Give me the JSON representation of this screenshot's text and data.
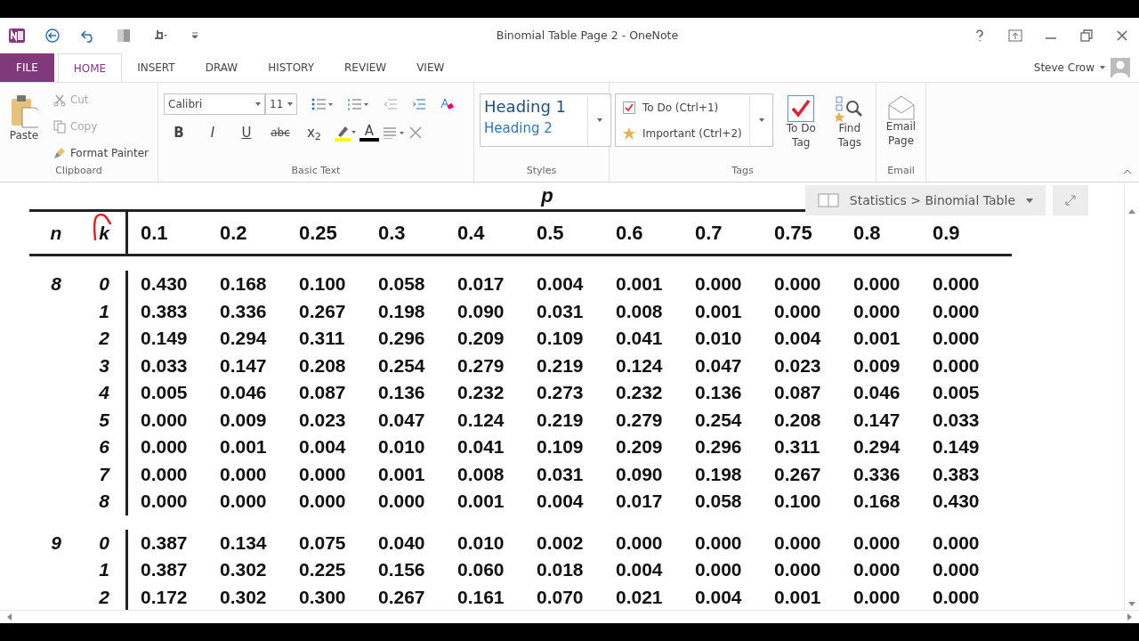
{
  "window": {
    "title": "Binomial Table Page 2 - OneNote"
  },
  "user": {
    "name": "Steve Crow"
  },
  "tabs": [
    {
      "label": "FILE",
      "kind": "file",
      "selected": false
    },
    {
      "label": "HOME",
      "kind": "tab",
      "selected": true
    },
    {
      "label": "INSERT",
      "kind": "tab",
      "selected": false
    },
    {
      "label": "DRAW",
      "kind": "tab",
      "selected": false
    },
    {
      "label": "HISTORY",
      "kind": "tab",
      "selected": false
    },
    {
      "label": "REVIEW",
      "kind": "tab",
      "selected": false
    },
    {
      "label": "VIEW",
      "kind": "tab",
      "selected": false
    }
  ],
  "clipboard": {
    "paste": "Paste",
    "group": "Clipboard",
    "items": [
      {
        "label": "Cut",
        "kind": "cut",
        "disabled": true
      },
      {
        "label": "Copy",
        "kind": "copy",
        "disabled": true
      },
      {
        "label": "Format Painter",
        "kind": "painter",
        "disabled": false
      }
    ]
  },
  "basic_text": {
    "font": "Calibri",
    "size": "11",
    "group": "Basic Text",
    "format_buttons": [
      {
        "label": "B",
        "kind": "bold"
      },
      {
        "label": "I",
        "kind": "italic"
      },
      {
        "label": "U",
        "kind": "underline"
      },
      {
        "label": "abc",
        "kind": "strike"
      },
      {
        "label": "x$_{2}$",
        "kind": "sub"
      }
    ],
    "font_color_label": "A"
  },
  "styles": {
    "items": [
      "Heading 1",
      "Heading 2"
    ],
    "group": "Styles"
  },
  "tags": {
    "group": "Tags",
    "items": [
      {
        "label": "To Do (Ctrl+1)",
        "kind": "checkbox"
      },
      {
        "label": "Important (Ctrl+2)",
        "kind": "star"
      }
    ],
    "buttons": [
      {
        "label": "To Do Tag",
        "kind": "todo"
      },
      {
        "label": "Find Tags",
        "kind": "find"
      }
    ]
  },
  "email": {
    "button": "Email Page",
    "group": "Email"
  },
  "breadcrumb": "Statistics > Binomial Table",
  "table": {
    "heading": "p",
    "columns": [
      "n",
      "k",
      "0.1",
      "0.2",
      "0.25",
      "0.3",
      "0.4",
      "0.5",
      "0.6",
      "0.7",
      "0.75",
      "0.8",
      "0.9"
    ],
    "groups": [
      {
        "n": "8",
        "rows": [
          {
            "k": "0",
            "values": [
              "0.430",
              "0.168",
              "0.100",
              "0.058",
              "0.017",
              "0.004",
              "0.001",
              "0.000",
              "0.000",
              "0.000",
              "0.000"
            ]
          },
          {
            "k": "1",
            "values": [
              "0.383",
              "0.336",
              "0.267",
              "0.198",
              "0.090",
              "0.031",
              "0.008",
              "0.001",
              "0.000",
              "0.000",
              "0.000"
            ]
          },
          {
            "k": "2",
            "values": [
              "0.149",
              "0.294",
              "0.311",
              "0.296",
              "0.209",
              "0.109",
              "0.041",
              "0.010",
              "0.004",
              "0.001",
              "0.000"
            ]
          },
          {
            "k": "3",
            "values": [
              "0.033",
              "0.147",
              "0.208",
              "0.254",
              "0.279",
              "0.219",
              "0.124",
              "0.047",
              "0.023",
              "0.009",
              "0.000"
            ]
          },
          {
            "k": "4",
            "values": [
              "0.005",
              "0.046",
              "0.087",
              "0.136",
              "0.232",
              "0.273",
              "0.232",
              "0.136",
              "0.087",
              "0.046",
              "0.005"
            ]
          },
          {
            "k": "5",
            "values": [
              "0.000",
              "0.009",
              "0.023",
              "0.047",
              "0.124",
              "0.219",
              "0.279",
              "0.254",
              "0.208",
              "0.147",
              "0.033"
            ]
          },
          {
            "k": "6",
            "values": [
              "0.000",
              "0.001",
              "0.004",
              "0.010",
              "0.041",
              "0.109",
              "0.209",
              "0.296",
              "0.311",
              "0.294",
              "0.149"
            ]
          },
          {
            "k": "7",
            "values": [
              "0.000",
              "0.000",
              "0.000",
              "0.001",
              "0.008",
              "0.031",
              "0.090",
              "0.198",
              "0.267",
              "0.336",
              "0.383"
            ]
          },
          {
            "k": "8",
            "values": [
              "0.000",
              "0.000",
              "0.000",
              "0.000",
              "0.001",
              "0.004",
              "0.017",
              "0.058",
              "0.100",
              "0.168",
              "0.430"
            ]
          }
        ]
      },
      {
        "n": "9",
        "rows": [
          {
            "k": "0",
            "values": [
              "0.387",
              "0.134",
              "0.075",
              "0.040",
              "0.010",
              "0.002",
              "0.000",
              "0.000",
              "0.000",
              "0.000",
              "0.000"
            ]
          },
          {
            "k": "1",
            "values": [
              "0.387",
              "0.302",
              "0.225",
              "0.156",
              "0.060",
              "0.018",
              "0.004",
              "0.000",
              "0.000",
              "0.000",
              "0.000"
            ]
          },
          {
            "k": "2",
            "values": [
              "0.172",
              "0.302",
              "0.300",
              "0.267",
              "0.161",
              "0.070",
              "0.021",
              "0.004",
              "0.001",
              "0.000",
              "0.000"
            ]
          }
        ]
      }
    ]
  }
}
